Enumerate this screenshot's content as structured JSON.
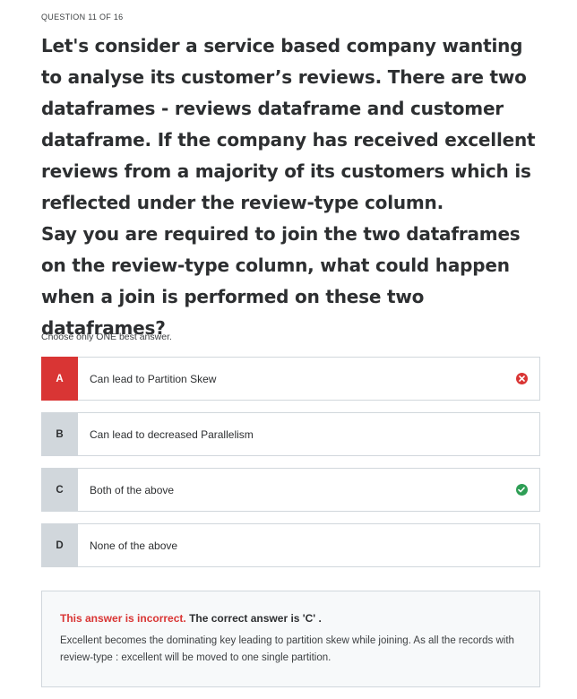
{
  "progress": "QUESTION 11 OF 16",
  "question": {
    "paragraph_1": "Let's consider a service based company wanting to analyse its customer’s reviews. There are two dataframes - reviews dataframe and customer dataframe. If the company has received excellent reviews from a majority of its customers which is reflected under the review-type column.",
    "paragraph_2": "Say you are required to join the two dataframes on the review-type column, what could happen when a join is performed on these two dataframes?"
  },
  "instruction": "Choose only ONE best answer.",
  "options": [
    {
      "letter": "A",
      "text": "Can lead to Partition Skew",
      "state": "selected-incorrect",
      "icon": "x-circle-icon"
    },
    {
      "letter": "B",
      "text": "Can lead to decreased Parallelism",
      "state": "neutral"
    },
    {
      "letter": "C",
      "text": "Both of the above",
      "state": "correct",
      "icon": "check-circle-icon"
    },
    {
      "letter": "D",
      "text": "None of the above",
      "state": "neutral"
    }
  ],
  "feedback": {
    "incorrect_label": "This answer is incorrect.",
    "correct_label": "The correct answer is 'C' .",
    "explanation": "Excellent becomes the dominating key leading to partition skew while joining. As all the records with review-type : excellent will be moved to one single partition."
  },
  "colors": {
    "incorrect": "#d93534",
    "correct": "#2e9e55",
    "neutral_letter_bg": "#d1d7dc",
    "feedback_bg": "#f7f9fa"
  }
}
